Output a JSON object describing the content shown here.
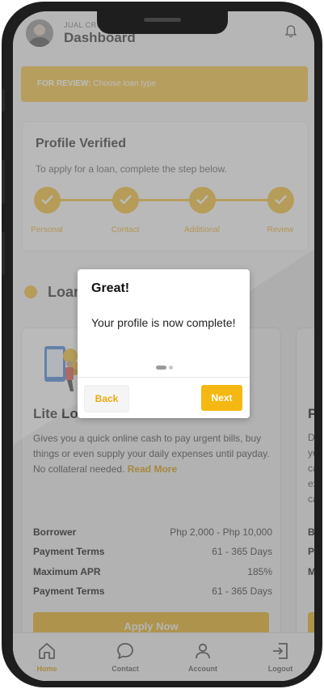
{
  "header": {
    "user_name": "JUAL CRUZ",
    "title": "Dashboard",
    "avatar_icon": "avatar-photo",
    "notification_icon": "bell-icon"
  },
  "review_banner": {
    "prefix": "FOR REVIEW:",
    "text": "Choose loan type"
  },
  "profile": {
    "title": "Profile Verified",
    "subtitle": "To apply for a loan, complete the step below.",
    "steps": [
      {
        "label": "Personal",
        "complete": true
      },
      {
        "label": "Contact",
        "complete": true
      },
      {
        "label": "Additional",
        "complete": true
      },
      {
        "label": "Review",
        "complete": true
      }
    ]
  },
  "loans_section": {
    "title": "Loan"
  },
  "loan_cards": [
    {
      "title": "Lite Loan",
      "description": "Gives you a quick online cash to pay urgent bills, buy things or even supply your daily expenses until payday. No collateral needed.",
      "read_more": "Read More",
      "details": [
        {
          "label": "Borrower",
          "value": "Php 2,000 - Php 10,000"
        },
        {
          "label": "Payment Terms",
          "value": "61 - 365 Days"
        },
        {
          "label": "Maximum APR",
          "value": "185%"
        },
        {
          "label": "Payment Terms",
          "value": "61 - 365 Days"
        }
      ],
      "apply_label": "Apply Now"
    },
    {
      "title_partial": "Pe",
      "desc_lines": [
        "Do",
        "yo",
        "ca",
        "ex",
        "ca"
      ],
      "detail_labels": [
        "Bo",
        "Pa",
        "Ma"
      ]
    }
  ],
  "tabs": [
    {
      "label": "Home",
      "icon": "home-icon",
      "active": true
    },
    {
      "label": "Contact",
      "icon": "chat-icon",
      "active": false
    },
    {
      "label": "Account",
      "icon": "user-icon",
      "active": false
    },
    {
      "label": "Logout",
      "icon": "logout-icon",
      "active": false
    }
  ],
  "modal": {
    "title": "Great!",
    "message": "Your profile is now complete!",
    "page_index": 1,
    "page_count": 2,
    "back_label": "Back",
    "next_label": "Next"
  },
  "colors": {
    "accent": "#f0b923",
    "accent_text": "#e7a91b",
    "overlay": "rgba(105,105,105,0.5)",
    "frame": "#1e1e1e"
  }
}
